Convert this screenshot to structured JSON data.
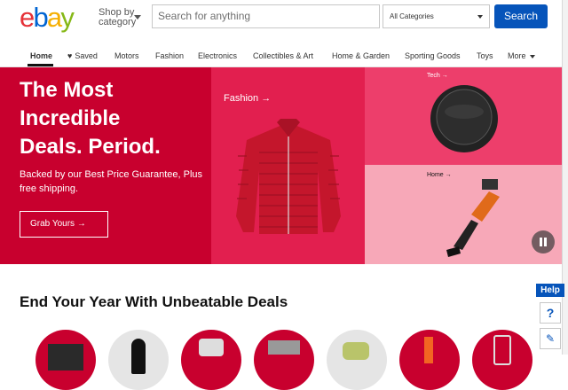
{
  "header": {
    "logo": {
      "e": "e",
      "b": "b",
      "a": "a",
      "y": "y"
    },
    "shop_by_category": {
      "line1": "Shop by",
      "line2": "category"
    },
    "search": {
      "placeholder": "Search for anything"
    },
    "category_select": {
      "selected": "All Categories"
    },
    "search_button": "Search"
  },
  "nav": {
    "items": [
      "Home",
      "Saved",
      "Motors",
      "Fashion",
      "Electronics",
      "Collectibles & Art",
      "Home & Garden",
      "Sporting Goods",
      "Toys",
      "More"
    ],
    "active": "Home"
  },
  "hero": {
    "title": "The Most\nIncredible\nDeals. Period.",
    "subtitle": "Backed by our Best Price Guarantee, Plus free shipping.",
    "cta": "Grab Yours →",
    "fashion_label": "Fashion →",
    "tech_label": "Tech →",
    "home_label": "Home →",
    "colors": {
      "main": "#c8002e",
      "fashion": "#e21f4f",
      "tech": "#ed3e6b",
      "home": "#f7a8b8"
    }
  },
  "section": {
    "title": "End Your Year With Unbeatable Deals"
  },
  "help": {
    "label": "Help",
    "question": "?",
    "feedback_icon": "feedback-icon"
  },
  "colors": {
    "brand_blue": "#0654ba",
    "logo_red": "#e53238",
    "logo_blue": "#0064d2",
    "logo_yellow": "#f5af02",
    "logo_green": "#86b817"
  }
}
